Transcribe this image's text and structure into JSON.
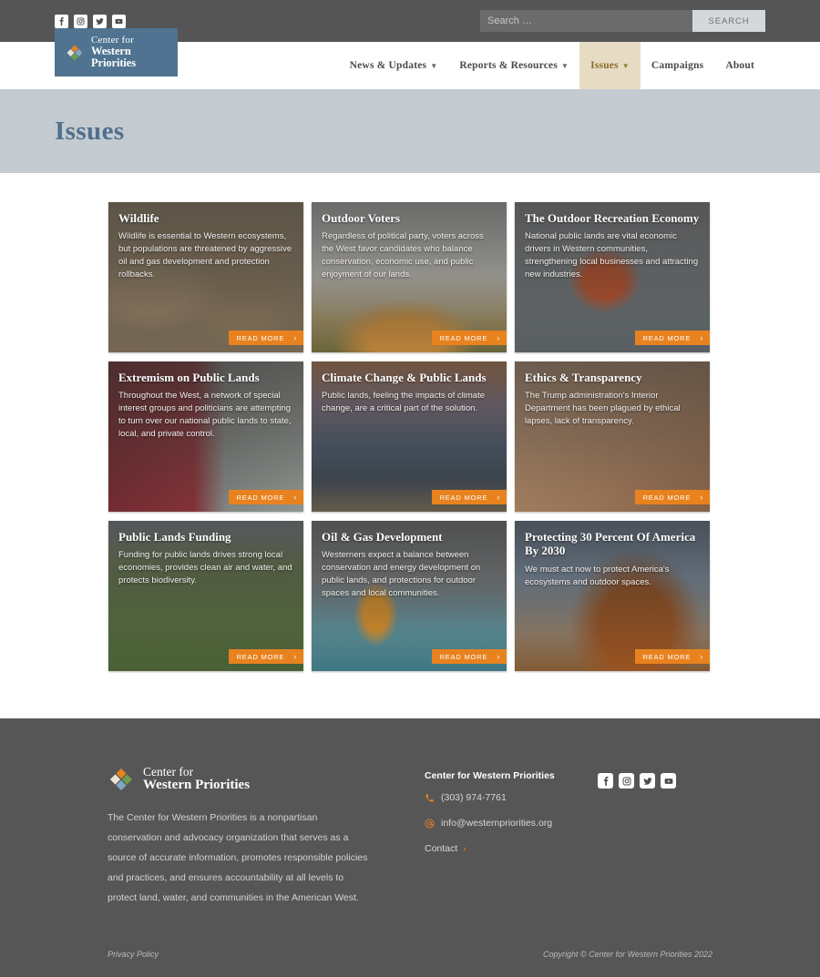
{
  "topbar": {
    "social": [
      {
        "name": "facebook-icon",
        "label": "Facebook"
      },
      {
        "name": "instagram-icon",
        "label": "Instagram"
      },
      {
        "name": "twitter-icon",
        "label": "Twitter"
      },
      {
        "name": "youtube-icon",
        "label": "YouTube"
      }
    ],
    "search": {
      "value": "",
      "placeholder": "Search …",
      "button_label": "SEARCH"
    }
  },
  "header": {
    "logo": {
      "line1": "Center for",
      "line2": "Western Priorities",
      "bg_color": "#4f7390"
    },
    "nav": [
      {
        "label": "News & Updates",
        "has_caret": true,
        "active": false
      },
      {
        "label": "Reports & Resources",
        "has_caret": true,
        "active": false
      },
      {
        "label": "Issues",
        "has_caret": true,
        "active": true
      },
      {
        "label": "Campaigns",
        "has_caret": false,
        "active": false
      },
      {
        "label": "About",
        "has_caret": false,
        "active": false
      }
    ],
    "active_color": "#8a6d28",
    "active_bg": "#e6dcc3"
  },
  "banner": {
    "title": "Issues",
    "bg_color": "#c3cbd1",
    "title_color": "#50708c"
  },
  "cards": [
    {
      "title": "Wildlife",
      "excerpt": "Wildlife is essential to Western ecosystems, but populations are threatened by aggressive oil and gas development and protection rollbacks.",
      "read_more": "READ MORE",
      "photo_class": "ph-wildlife"
    },
    {
      "title": "Outdoor Voters",
      "excerpt": "Regardless of political party, voters across the West favor candidates who balance conservation, economic use, and public enjoyment of our lands.",
      "read_more": "READ MORE",
      "photo_class": "ph-voters"
    },
    {
      "title": "The Outdoor Recreation Economy",
      "excerpt": "National public lands are vital economic drivers in Western communities, strengthening local businesses and attracting new industries.",
      "read_more": "READ MORE",
      "photo_class": "ph-recreation"
    },
    {
      "title": "Extremism on Public Lands",
      "excerpt": "Throughout the West, a network of special interest groups and politicians are attempting to turn over our national public lands to state, local, and private control.",
      "read_more": "READ MORE",
      "photo_class": "ph-extremism"
    },
    {
      "title": "Climate Change & Public Lands",
      "excerpt": "Public lands, feeling the impacts of climate change, are a critical part of the solution.",
      "read_more": "READ MORE",
      "photo_class": "ph-climate"
    },
    {
      "title": "Ethics & Transparency",
      "excerpt": "The Trump administration's Interior Department has been plagued by ethical lapses, lack of transparency.",
      "read_more": "READ MORE",
      "photo_class": "ph-ethics"
    },
    {
      "title": "Public Lands Funding",
      "excerpt": "Funding for public lands drives strong local economies, provides clean air and water, and protects biodiversity.",
      "read_more": "READ MORE",
      "photo_class": "ph-funding"
    },
    {
      "title": "Oil & Gas Development",
      "excerpt": "Westerners expect a balance between conservation and energy development on public lands, and protections for outdoor spaces and local communities.",
      "read_more": "READ MORE",
      "photo_class": "ph-oilgas"
    },
    {
      "title": "Protecting 30 Percent Of America By 2030",
      "excerpt": "We must act now to protect America's ecosystems and outdoor spaces.",
      "read_more": "READ MORE",
      "photo_class": "ph-30x30"
    }
  ],
  "footer": {
    "logo": {
      "line1": "Center for",
      "line2": "Western Priorities"
    },
    "about": "The Center for Western Priorities is a nonpartisan conservation and advocacy organization that serves as a source of accurate information, promotes responsible policies and practices, and ensures accountability at all levels to protect land, water, and communities in the American West.",
    "contact": {
      "title": "Center for Western Priorities",
      "phone": "(303) 974-7761",
      "email": "info@westernpriorities.org",
      "contact_link": "Contact"
    },
    "social": [
      {
        "name": "facebook-icon",
        "label": "Facebook"
      },
      {
        "name": "instagram-icon",
        "label": "Instagram"
      },
      {
        "name": "twitter-icon",
        "label": "Twitter"
      },
      {
        "name": "youtube-icon",
        "label": "YouTube"
      }
    ],
    "bottom": {
      "privacy": "Privacy Policy",
      "copyright": "Copyright © Center for Western Priorities 2022"
    },
    "bg_color": "#565656",
    "accent_color": "#e8821e"
  }
}
